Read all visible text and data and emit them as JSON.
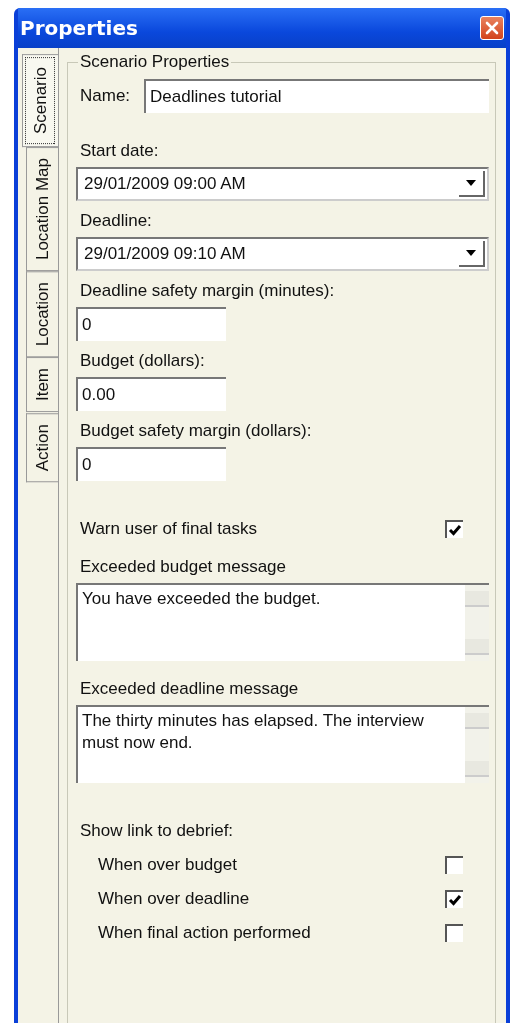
{
  "window": {
    "title": "Properties"
  },
  "tabs": [
    {
      "label": "Scenario",
      "selected": true
    },
    {
      "label": "Location Map",
      "selected": false
    },
    {
      "label": "Location",
      "selected": false
    },
    {
      "label": "Item",
      "selected": false
    },
    {
      "label": "Action",
      "selected": false
    }
  ],
  "group": {
    "title": "Scenario Properties"
  },
  "name_field": {
    "label": "Name:",
    "value": "Deadlines tutorial"
  },
  "fields": [
    {
      "kind": "dropdown",
      "label": "Start date:",
      "value": "29/01/2009 09:00 AM"
    },
    {
      "kind": "dropdown",
      "label": "Deadline:",
      "value": "29/01/2009 09:10 AM"
    },
    {
      "kind": "text",
      "label": "Deadline safety margin (minutes):",
      "value": "0"
    },
    {
      "kind": "text",
      "label": "Budget (dollars):",
      "value": "0.00"
    },
    {
      "kind": "text",
      "label": "Budget safety margin (dollars):",
      "value": "0"
    }
  ],
  "warn": {
    "label": "Warn user of final tasks",
    "checked": true
  },
  "messages": [
    {
      "label": "Exceeded budget message",
      "value": "You have exceeded the budget."
    },
    {
      "label": "Exceeded deadline message",
      "value": "The thirty minutes has elapsed. The interview must now end."
    }
  ],
  "debrief": {
    "label": "Show link to debrief:",
    "options": [
      {
        "label": "When over budget",
        "checked": false
      },
      {
        "label": "When over deadline",
        "checked": true
      },
      {
        "label": "When final action performed",
        "checked": false
      }
    ]
  }
}
